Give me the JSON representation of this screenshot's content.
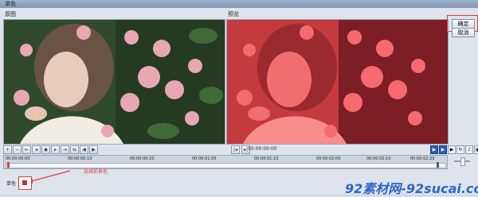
{
  "window": {
    "title": "单色"
  },
  "panels": {
    "original_label": "原图",
    "result_label": "预览"
  },
  "buttons": {
    "ok": "确定",
    "cancel": "取消"
  },
  "transport": {
    "timecode": "00:00:00:00"
  },
  "timeline": {
    "ruler": [
      "00:00:00:00",
      "00:00:00:10",
      "00:00:00:20",
      "00:00:01:05",
      "00:00:01:15",
      "00:00:02:00",
      "00:00:02:10",
      "00:00:02:20"
    ]
  },
  "annotation": {
    "text": "选择前景色"
  },
  "color": {
    "label": "单色",
    "value": "#c0303a"
  },
  "watermark": {
    "text": "92素材网-92sucai.com"
  }
}
